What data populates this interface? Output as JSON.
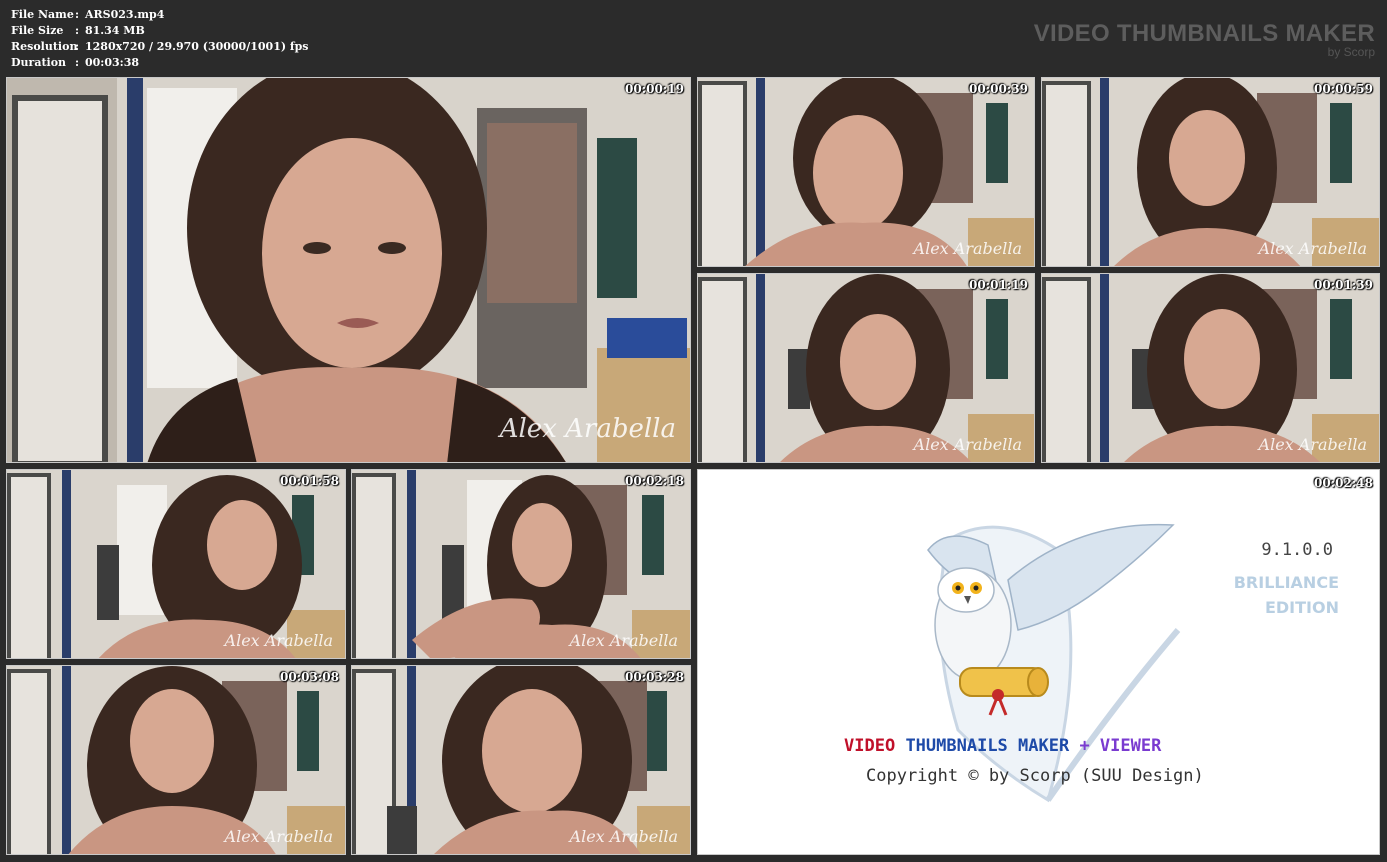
{
  "header": {
    "file_name_label": "File Name",
    "file_name": "ARS023.mp4",
    "file_size_label": "File Size",
    "file_size": "81.34 MB",
    "resolution_label": "Resolution",
    "resolution": "1280x720 / 29.970 (30000/1001) fps",
    "duration_label": "Duration",
    "duration": "00:03:38",
    "separator": ":",
    "brand_title": "VIDEO THUMBNAILS MAKER",
    "brand_sub": "by Scorp"
  },
  "thumbnails": [
    {
      "time": "00:00:19",
      "watermark": "Alex Arabella"
    },
    {
      "time": "00:00:39",
      "watermark": "Alex Arabella"
    },
    {
      "time": "00:00:59",
      "watermark": "Alex Arabella"
    },
    {
      "time": "00:01:19",
      "watermark": "Alex Arabella"
    },
    {
      "time": "00:01:39",
      "watermark": "Alex Arabella"
    },
    {
      "time": "00:01:58",
      "watermark": "Alex Arabella"
    },
    {
      "time": "00:02:18",
      "watermark": "Alex Arabella"
    },
    {
      "time": "00:03:08",
      "watermark": "Alex Arabella"
    },
    {
      "time": "00:03:28",
      "watermark": "Alex Arabella"
    }
  ],
  "logo_card": {
    "time": "00:02:48",
    "version": "9.1.0.0",
    "edition_line1": "BRILLIANCE",
    "edition_line2": "EDITION",
    "product_part1": "VIDEO",
    "product_part2": "THUMBNAILS MAKER",
    "product_part3": "+ VIEWER",
    "copyright": "Copyright © by Scorp (SUU Design)"
  },
  "colors": {
    "background": "#2b2b2b",
    "brand_text": "#5d5d5d",
    "product_red": "#c0102a",
    "product_blue": "#1e4aa8",
    "product_purple": "#7a3bd0",
    "edition_blue": "#b8cfe2"
  },
  "icons": {
    "logo": "snowy-owl-with-scroll-icon"
  }
}
